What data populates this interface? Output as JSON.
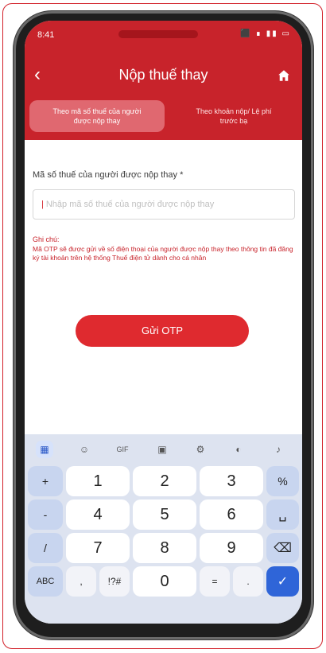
{
  "status": {
    "time": "8:41",
    "icons": "⬛ ∎ ▮▮ ▭"
  },
  "nav": {
    "title": "Nộp thuế thay",
    "back_icon": "chevron-left",
    "home_icon": "house"
  },
  "tabs": [
    {
      "label": "Theo mã số thuế của người được nộp thay",
      "active": true
    },
    {
      "label": "Theo khoản nộp/ Lệ phí trước bạ",
      "active": false
    }
  ],
  "form": {
    "label": "Mã số thuế của người được nộp thay *",
    "placeholder": "Nhập mã số thuế của người được nộp thay",
    "note_title": "Ghi chú:",
    "note_text": "Mã OTP sẽ được gửi về số điện thoại của người được nộp thay theo thông tin đã đăng ký tài khoản trên hệ thống Thuế điện tử dành cho cá nhân",
    "otp_button": "Gửi OTP"
  },
  "keyboard": {
    "toolbar": [
      "grid",
      "sticker",
      "GIF",
      "clipboard",
      "settings",
      "palette",
      "mic"
    ],
    "gif_label": "GIF",
    "row1": [
      "+",
      "1",
      "2",
      "3",
      "%"
    ],
    "row2": [
      "-",
      "4",
      "5",
      "6",
      "space"
    ],
    "row3": [
      "/",
      "7",
      "8",
      "9",
      "backspace"
    ],
    "row4": [
      "ABC",
      ",",
      "!?#",
      "0",
      "=",
      ".",
      "enter"
    ]
  },
  "colors": {
    "brand_red": "#c8232b",
    "enter_blue": "#2f65d8"
  }
}
